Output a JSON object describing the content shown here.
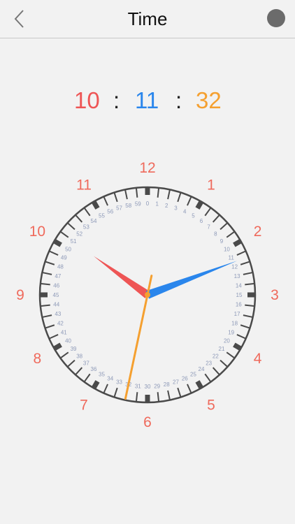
{
  "nav": {
    "title": "Time",
    "back_icon": "chevron-left-icon",
    "record_icon": "filled-circle-icon"
  },
  "time": {
    "hours": "10",
    "minutes": "11",
    "seconds": "32",
    "separator": ":"
  },
  "clock": {
    "hour_numbers": [
      "12",
      "1",
      "2",
      "3",
      "4",
      "5",
      "6",
      "7",
      "8",
      "9",
      "10",
      "11"
    ],
    "minute_numbers": [
      "0",
      "1",
      "2",
      "3",
      "4",
      "5",
      "6",
      "7",
      "8",
      "9",
      "10",
      "11",
      "12",
      "13",
      "14",
      "15",
      "16",
      "17",
      "18",
      "19",
      "20",
      "21",
      "22",
      "23",
      "24",
      "25",
      "26",
      "27",
      "28",
      "29",
      "30",
      "31",
      "32",
      "33",
      "34",
      "35",
      "36",
      "37",
      "38",
      "39",
      "40",
      "41",
      "42",
      "43",
      "44",
      "45",
      "46",
      "47",
      "48",
      "49",
      "50",
      "51",
      "52",
      "53",
      "54",
      "55",
      "56",
      "57",
      "58",
      "59"
    ],
    "time_hours": 10,
    "time_minutes": 11,
    "time_seconds": 32
  },
  "colors": {
    "hour": "#ee5555",
    "minute": "#2a86ec",
    "second": "#f5a030",
    "hour_numbers": "#ef6a5c",
    "minute_numbers": "#8e9ab8",
    "ring": "#4a4a4a"
  }
}
